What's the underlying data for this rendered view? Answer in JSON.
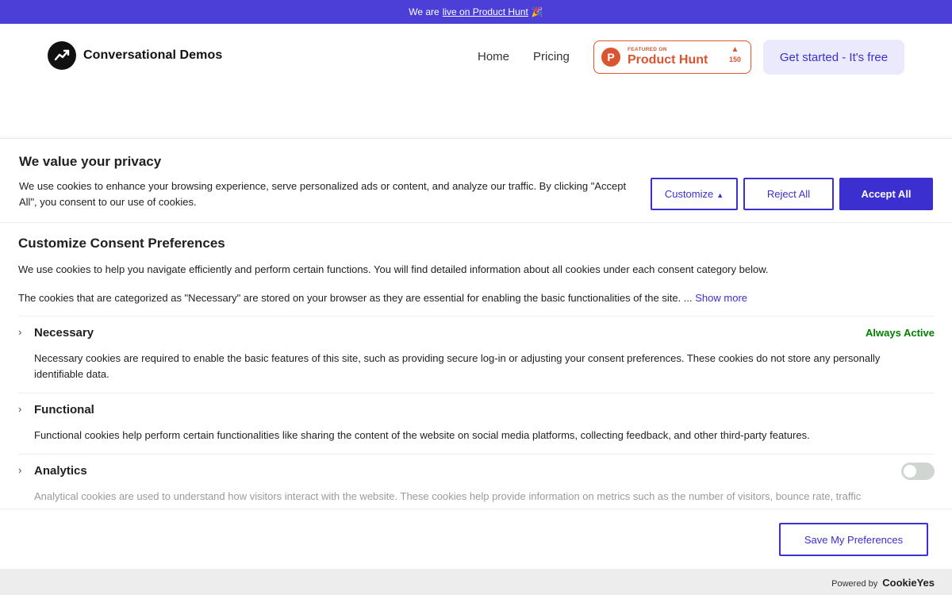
{
  "promo": {
    "prefix": "We are",
    "link": "live on Product Hunt",
    "emoji": "🎉"
  },
  "nav": {
    "brand": "Conversational Demos",
    "links": [
      "Home",
      "Pricing"
    ],
    "ph_badge": {
      "small": "FEATURED ON",
      "big": "Product Hunt",
      "votes": "150"
    },
    "cta": "Get started - It's free"
  },
  "banner": {
    "title": "We value your privacy",
    "description": "We use cookies to enhance your browsing experience, serve personalized ads or content, and analyze our traffic. By clicking \"Accept All\", you consent to our use of cookies.",
    "customize": "Customize",
    "reject": "Reject All",
    "accept": "Accept All"
  },
  "prefs": {
    "title": "Customize Consent Preferences",
    "p1": "We use cookies to help you navigate efficiently and perform certain functions. You will find detailed information about all cookies under each consent category below.",
    "p2": "The cookies that are categorized as \"Necessary\" are stored on your browser as they are essential for enabling the basic functionalities of the site. ...",
    "show_more": "Show more",
    "categories": [
      {
        "name": "Necessary",
        "status": "Always Active",
        "description": "Necessary cookies are required to enable the basic features of this site, such as providing secure log-in or adjusting your consent preferences. These cookies do not store any personally identifiable data."
      },
      {
        "name": "Functional",
        "description": "Functional cookies help perform certain functionalities like sharing the content of the website on social media platforms, collecting feedback, and other third-party features."
      },
      {
        "name": "Analytics",
        "enabled": false,
        "description": "Analytical cookies are used to understand how visitors interact with the website. These cookies help provide information on metrics such as the number of visitors, bounce rate, traffic"
      }
    ],
    "save": "Save My Preferences"
  },
  "footer": {
    "powered_by": "Powered by",
    "brand": "CookieYes"
  },
  "colors": {
    "promo_bg": "#4b3fd8",
    "accent": "#3b2fcf",
    "active_green": "#008000",
    "ph_orange": "#da552f"
  }
}
